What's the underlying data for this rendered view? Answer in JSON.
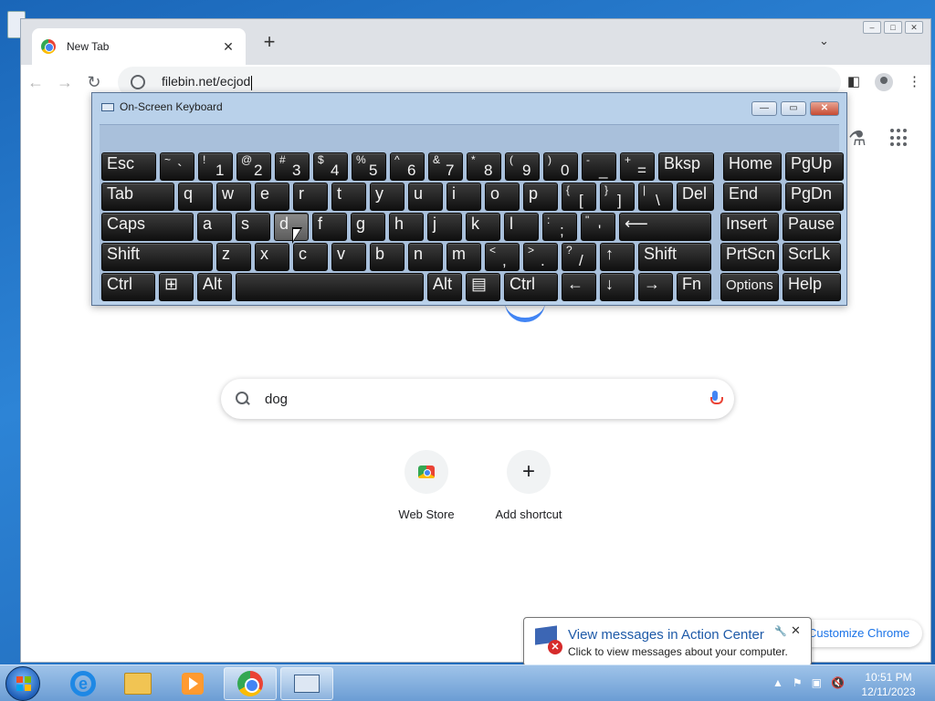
{
  "browser": {
    "tab_title": "New Tab",
    "tab_close": "✕",
    "new_tab": "+",
    "tab_menu": "⌄",
    "url": "filebin.net/ecjod"
  },
  "page": {
    "search_query": "dog",
    "shortcuts": [
      {
        "label": "Web Store"
      },
      {
        "label": "Add shortcut",
        "icon_text": "+"
      }
    ],
    "customize_label": "Customize Chrome"
  },
  "osk": {
    "title": "On-Screen Keyboard",
    "rows": [
      [
        {
          "m": "Esc",
          "w": 60
        },
        {
          "s": "~",
          "d": "`",
          "w": 38
        },
        {
          "s": "!",
          "d": "1",
          "w": 38
        },
        {
          "s": "@",
          "d": "2",
          "w": 38
        },
        {
          "s": "#",
          "d": "3",
          "w": 38
        },
        {
          "s": "$",
          "d": "4",
          "w": 38
        },
        {
          "s": "%",
          "d": "5",
          "w": 38
        },
        {
          "s": "^",
          "d": "6",
          "w": 38
        },
        {
          "s": "&",
          "d": "7",
          "w": 38
        },
        {
          "s": "*",
          "d": "8",
          "w": 38
        },
        {
          "s": "(",
          "d": "9",
          "w": 38
        },
        {
          "s": ")",
          "d": "0",
          "w": 38
        },
        {
          "s": "-",
          "d": "_",
          "w": 38
        },
        {
          "s": "+",
          "d": "=",
          "w": 38
        },
        {
          "m": "Bksp",
          "w": 61
        },
        {
          "m": "Home",
          "w": 64,
          "gap": 6
        },
        {
          "m": "PgUp",
          "w": 64
        }
      ],
      [
        {
          "m": "Tab",
          "w": 80
        },
        {
          "m": "q",
          "w": 38
        },
        {
          "m": "w",
          "w": 38
        },
        {
          "m": "e",
          "w": 38
        },
        {
          "m": "r",
          "w": 38
        },
        {
          "m": "t",
          "w": 38
        },
        {
          "m": "y",
          "w": 38
        },
        {
          "m": "u",
          "w": 38
        },
        {
          "m": "i",
          "w": 38
        },
        {
          "m": "o",
          "w": 38
        },
        {
          "m": "p",
          "w": 38
        },
        {
          "s": "{",
          "d": "[",
          "w": 38
        },
        {
          "s": "}",
          "d": "]",
          "w": 38
        },
        {
          "s": "|",
          "d": "\\",
          "w": 38
        },
        {
          "m": "Del",
          "w": 41
        },
        {
          "m": "End",
          "w": 64,
          "gap": 6
        },
        {
          "m": "PgDn",
          "w": 64
        }
      ],
      [
        {
          "m": "Caps",
          "w": 101
        },
        {
          "m": "a",
          "w": 38
        },
        {
          "m": "s",
          "w": 38
        },
        {
          "m": "d",
          "w": 38,
          "hover": true
        },
        {
          "m": "f",
          "w": 38
        },
        {
          "m": "g",
          "w": 38
        },
        {
          "m": "h",
          "w": 38
        },
        {
          "m": "j",
          "w": 38
        },
        {
          "m": "k",
          "w": 38
        },
        {
          "m": "l",
          "w": 38
        },
        {
          "s": ":",
          "d": ";",
          "w": 38
        },
        {
          "s": "\"",
          "d": "'",
          "w": 38
        },
        {
          "m": "⟵",
          "w": 101
        },
        {
          "m": "Insert",
          "w": 64,
          "gap": 6
        },
        {
          "m": "Pause",
          "w": 64
        }
      ],
      [
        {
          "m": "Shift",
          "w": 122
        },
        {
          "m": "z",
          "w": 38
        },
        {
          "m": "x",
          "w": 38
        },
        {
          "m": "c",
          "w": 38
        },
        {
          "m": "v",
          "w": 38
        },
        {
          "m": "b",
          "w": 38
        },
        {
          "m": "n",
          "w": 38
        },
        {
          "m": "m",
          "w": 38
        },
        {
          "s": "<",
          "d": ",",
          "w": 38
        },
        {
          "s": ">",
          "d": ".",
          "w": 38
        },
        {
          "s": "?",
          "d": "/",
          "w": 38
        },
        {
          "m": "↑",
          "w": 38
        },
        {
          "m": "Shift",
          "w": 80
        },
        {
          "m": "PrtScn",
          "w": 64,
          "gap": 6
        },
        {
          "m": "ScrLk",
          "w": 64
        }
      ],
      [
        {
          "m": "Ctrl",
          "w": 59
        },
        {
          "m": "⊞",
          "w": 38
        },
        {
          "m": "Alt",
          "w": 38
        },
        {
          "m": "",
          "w": 206
        },
        {
          "m": "Alt",
          "w": 38
        },
        {
          "m": "▤",
          "w": 38
        },
        {
          "m": "Ctrl",
          "w": 59
        },
        {
          "m": "←",
          "w": 38
        },
        {
          "m": "↓",
          "w": 38
        },
        {
          "m": "→",
          "w": 38
        },
        {
          "m": "Fn",
          "w": 38
        },
        {
          "m": "Options",
          "w": 64,
          "gap": 6,
          "small": true
        },
        {
          "m": "Help",
          "w": 64
        }
      ]
    ]
  },
  "balloon": {
    "heading": "View messages in Action Center",
    "text": "Click to view messages about your computer."
  },
  "taskbar": {
    "time": "10:51 PM",
    "date": "12/11/2023"
  },
  "icons": [
    "chrome-icon",
    "search-icon",
    "mic-icon",
    "flask-icon",
    "apps-icon",
    "keyboard-icon",
    "action-center-icon"
  ]
}
